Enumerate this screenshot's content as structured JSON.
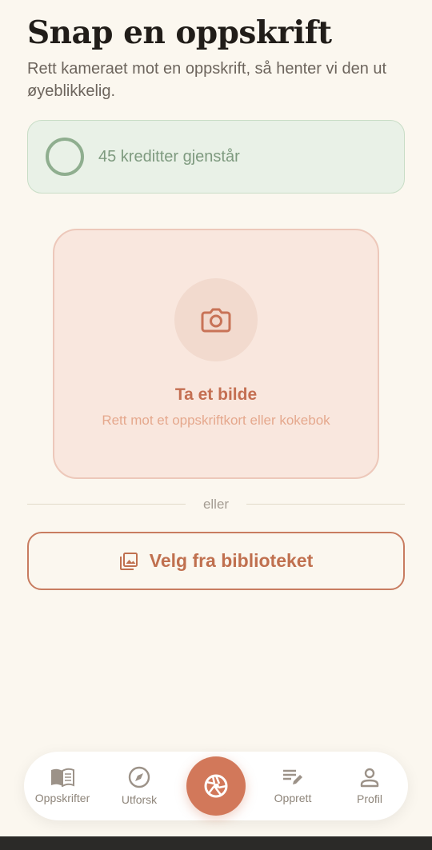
{
  "header": {
    "title": "Snap en oppskrift",
    "subtitle": "Rett kameraet mot en oppskrift, så henter vi den ut øyeblikkelig."
  },
  "credits": {
    "text": "45 kreditter gjenstår"
  },
  "camera_card": {
    "title": "Ta et bilde",
    "subtitle": "Rett mot et oppskriftkort eller kokebok",
    "icon": "camera-icon"
  },
  "divider": {
    "label": "eller"
  },
  "library_button": {
    "label": "Velg fra biblioteket",
    "icon": "gallery-icon"
  },
  "bottom_nav": {
    "items": [
      {
        "label": "Oppskrifter",
        "icon": "book-icon"
      },
      {
        "label": "Utforsk",
        "icon": "compass-icon"
      },
      {
        "label": "Opprett",
        "icon": "edit-list-icon"
      },
      {
        "label": "Profil",
        "icon": "person-icon"
      }
    ],
    "center_icon": "shutter-icon"
  },
  "colors": {
    "background": "#FBF7EF",
    "accent": "#D2785A",
    "credits_bg": "#E9F1E7",
    "credits_text": "#7E9A7F",
    "card_bg": "#F9E7DE"
  }
}
